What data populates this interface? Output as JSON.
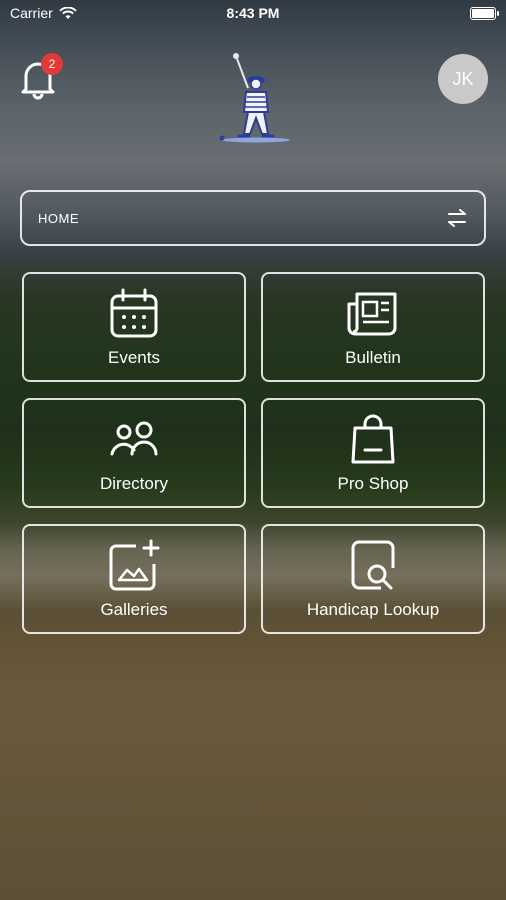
{
  "status_bar": {
    "carrier": "Carrier",
    "time": "8:43 PM"
  },
  "header": {
    "notification_count": "2",
    "avatar_initials": "JK"
  },
  "nav": {
    "home_label": "HOME"
  },
  "tiles": [
    {
      "label": "Events",
      "icon": "calendar-icon"
    },
    {
      "label": "Bulletin",
      "icon": "newspaper-icon"
    },
    {
      "label": "Directory",
      "icon": "people-icon"
    },
    {
      "label": "Pro Shop",
      "icon": "shopping-bag-icon"
    },
    {
      "label": "Galleries",
      "icon": "gallery-add-icon"
    },
    {
      "label": "Handicap Lookup",
      "icon": "document-search-icon"
    }
  ],
  "colors": {
    "badge": "#e53935",
    "avatar_bg": "#c9c9c9",
    "border": "#ffffff"
  }
}
